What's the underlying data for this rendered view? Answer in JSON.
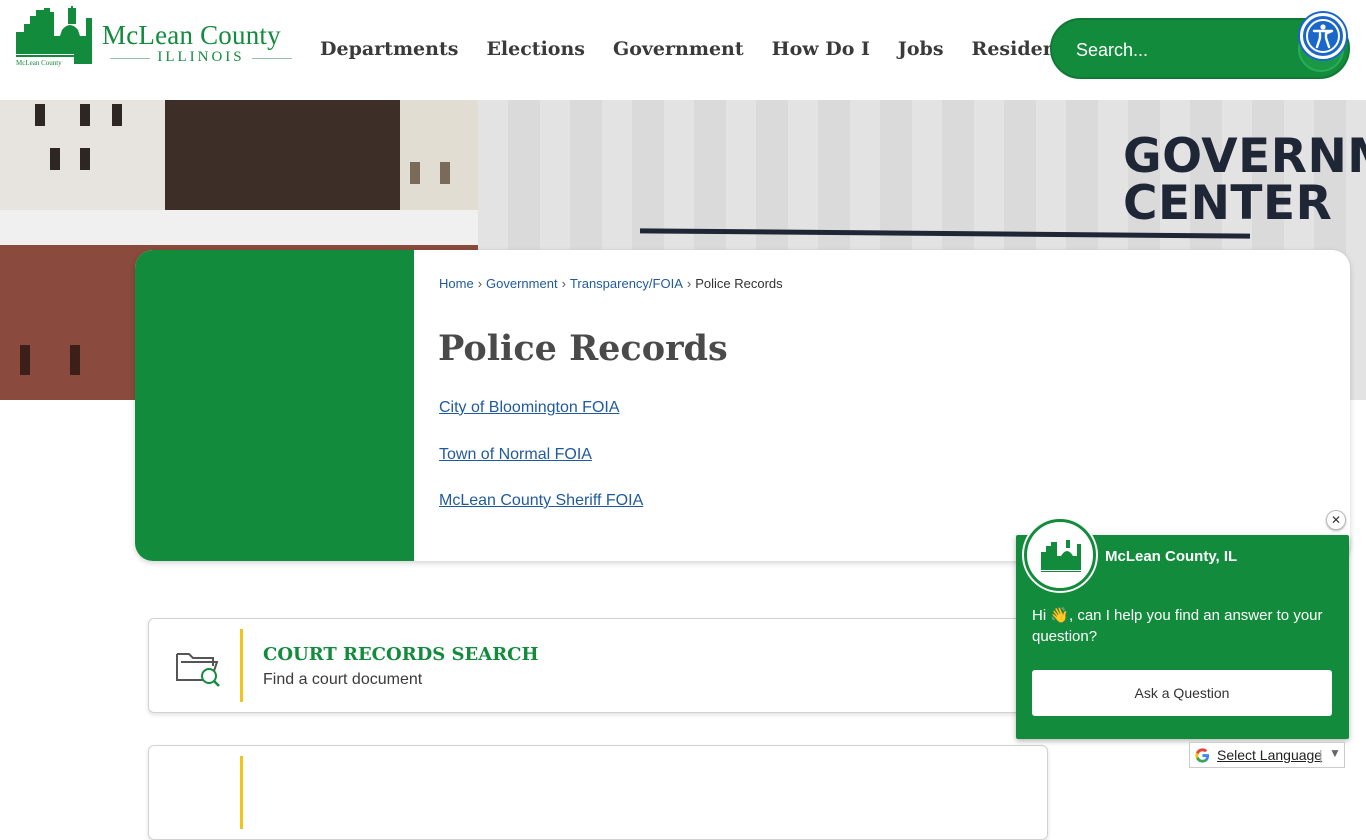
{
  "logo": {
    "name": "McLean County",
    "state": "ILLINOIS",
    "small_text": "McLean County"
  },
  "nav": {
    "items": [
      "Departments",
      "Elections",
      "Government",
      "How Do I",
      "Jobs",
      "Residents"
    ]
  },
  "search": {
    "placeholder": "Search..."
  },
  "hero": {
    "sign_line1": "GOVERNMENT",
    "sign_line2": "CENTER"
  },
  "breadcrumb": {
    "items": [
      "Home",
      "Government",
      "Transparency/FOIA"
    ],
    "separator": "›",
    "current": "Police Records"
  },
  "page": {
    "title": "Police Records",
    "links": [
      "City of Bloomington FOIA",
      "Town of Normal FOIA",
      "McLean County Sheriff FOIA"
    ]
  },
  "quick_links": [
    {
      "title": "COURT RECORDS SEARCH",
      "subtitle": "Find a court document",
      "icon": "folder-search-icon"
    }
  ],
  "chat": {
    "name": "McLean County, IL",
    "message": "Hi 👋, can I help you find an answer to your question?",
    "button_label": "Ask a Question",
    "close_label": "✕"
  },
  "translate": {
    "label": "Select Language",
    "separator": "|",
    "arrow": "▼"
  },
  "colors": {
    "brand_green": "#138b3c",
    "accent_yellow": "#f2c318",
    "link_blue": "#1f5a9e",
    "a11y_blue": "#1a67c9"
  }
}
